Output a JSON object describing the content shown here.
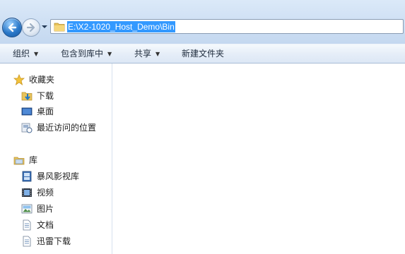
{
  "address": {
    "path": "E:\\X2-1020_Host_Demo\\Bin"
  },
  "toolbar": {
    "organize": "组织",
    "include_library": "包含到库中",
    "share": "共享",
    "new_folder": "新建文件夹"
  },
  "nav": {
    "favorites": {
      "label": "收藏夹",
      "items": [
        "下载",
        "桌面",
        "最近访问的位置"
      ]
    },
    "libraries": {
      "label": "库",
      "items": [
        "暴风影视库",
        "视频",
        "图片",
        "文档",
        "迅雷下载"
      ]
    }
  },
  "colors": {
    "selection": "#3399ff",
    "accent": "#2a78c9"
  },
  "icons": {
    "back": "back-arrow-icon",
    "forward": "forward-arrow-icon",
    "history": "chevron-down-icon",
    "folder": "folder-icon",
    "star": "star-icon",
    "download": "download-folder-icon",
    "desktop": "desktop-icon",
    "recent": "recent-places-icon",
    "library": "library-icon",
    "video_library": "video-library-icon",
    "video": "video-icon",
    "pictures": "pictures-icon",
    "documents": "documents-icon",
    "thunder": "thunder-download-icon"
  }
}
